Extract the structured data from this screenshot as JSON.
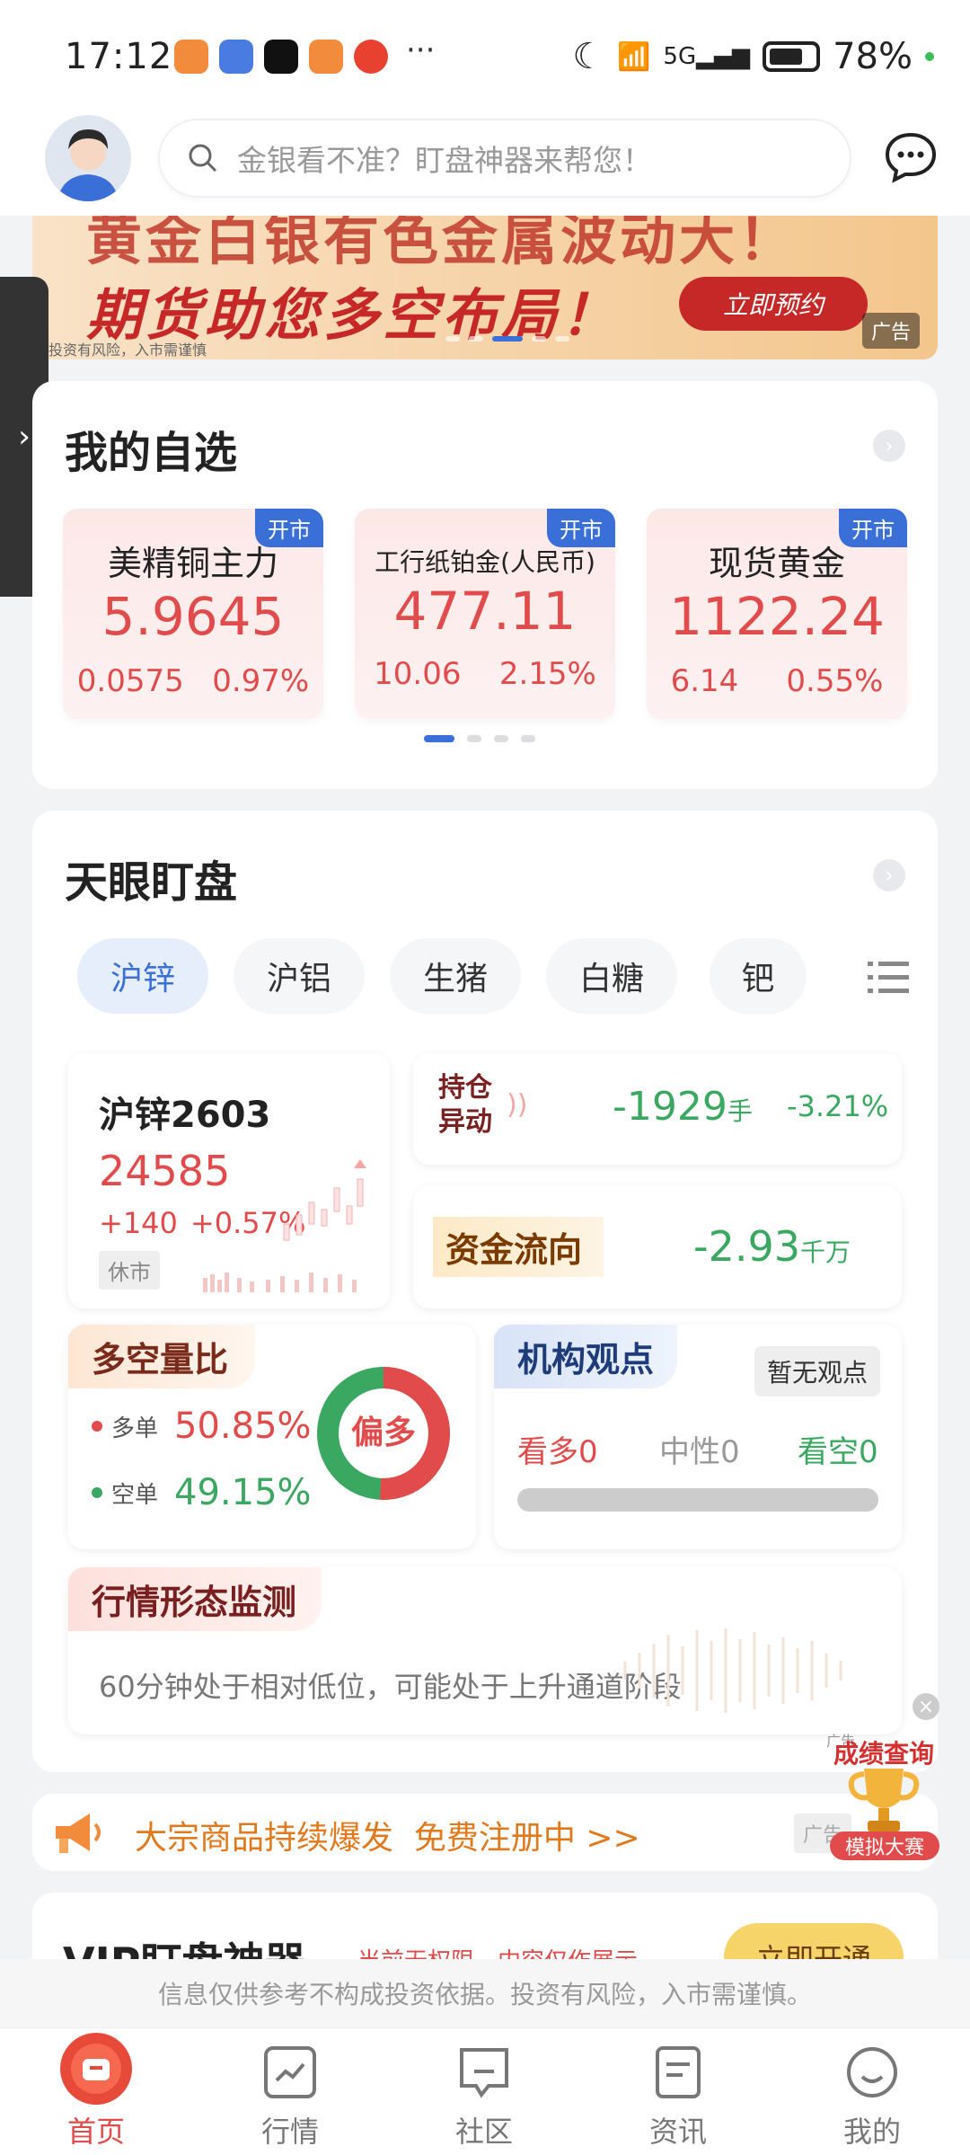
{
  "status_bar": {
    "time": "17:12",
    "more": "···",
    "battery": "78%"
  },
  "search": {
    "placeholder": "金银看不准？盯盘神器来帮您！"
  },
  "banner": {
    "line1": "黄金白银有色金属波动大！",
    "line2": "期货助您多空布局！",
    "button": "立即预约",
    "risk": "投资有风险，入市需谨慎",
    "ad": "广告"
  },
  "watchlist": {
    "title": "我的自选",
    "items": [
      {
        "tag": "开市",
        "name": "美精铜主力",
        "price": "5.9645",
        "change": "0.0575",
        "pct": "0.97%"
      },
      {
        "tag": "开市",
        "name": "工行纸铂金(人民币)",
        "price": "477.11",
        "change": "10.06",
        "pct": "2.15%"
      },
      {
        "tag": "开市",
        "name": "现货黄金",
        "price": "1122.24",
        "change": "6.14",
        "pct": "0.55%"
      }
    ]
  },
  "monitor": {
    "title": "天眼盯盘",
    "tabs": [
      "沪锌",
      "沪铝",
      "生猪",
      "白糖",
      "钯"
    ],
    "contract": {
      "name": "沪锌2603",
      "price": "24585",
      "change": "+140",
      "pct": "+0.57%",
      "status": "休市"
    },
    "position": {
      "label1": "持仓",
      "label2": "异动",
      "value": "-1929",
      "unit": "手",
      "pct": "-3.21%"
    },
    "fund": {
      "label": "资金流向",
      "value": "-2.93",
      "unit": "千万"
    },
    "ratio": {
      "title": "多空量比",
      "long_label": "多单",
      "long_value": "50.85%",
      "long_share": 50.85,
      "short_label": "空单",
      "short_value": "49.15%",
      "center": "偏多"
    },
    "institution": {
      "title": "机构观点",
      "badge": "暂无观点",
      "bull": "看多0",
      "neutral": "中性0",
      "bear": "看空0"
    },
    "pattern": {
      "title": "行情形态监测",
      "text": "60分钟处于相对低位，可能处于上升通道阶段"
    }
  },
  "promo": {
    "text": "大宗商品持续爆发  免费注册中 >>",
    "ad": "广告"
  },
  "float_ad": {
    "title": "成绩查询",
    "sub": "模拟大赛",
    "ad": "广告"
  },
  "vip": {
    "title": "VIP盯盘神器",
    "subtitle": "当前无权限，内容仅作展示",
    "button": "立即开通"
  },
  "disclaimer": "信息仅供参考不构成投资依据。投资有风险，入市需谨慎。",
  "tabbar": [
    "首页",
    "行情",
    "社区",
    "资讯",
    "我的"
  ],
  "colors": {
    "red": "#e24b4b",
    "green": "#3aa860",
    "blue": "#3b6fd8"
  }
}
